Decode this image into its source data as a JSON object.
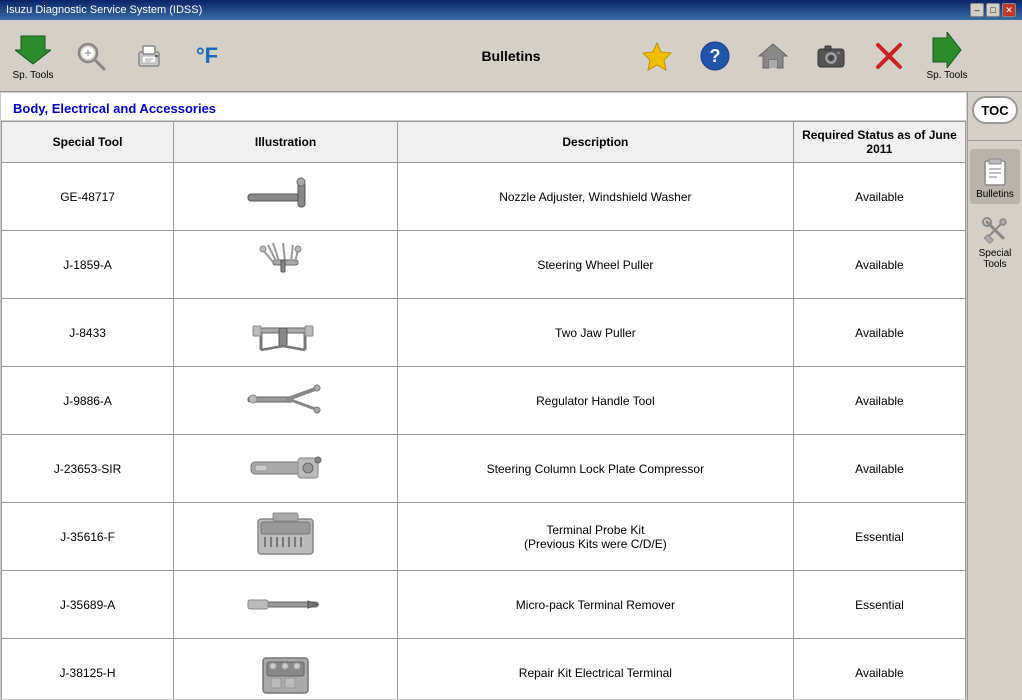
{
  "titlebar": {
    "title": "Isuzu Diagnostic Service System (IDSS)",
    "min_btn": "–",
    "max_btn": "□",
    "close_btn": "✕"
  },
  "toolbar": {
    "center_label": "Bulletins",
    "left_tools": [
      {
        "id": "sp-tools-left",
        "label": "Sp. Tools"
      },
      {
        "id": "magnifier",
        "label": ""
      },
      {
        "id": "printer",
        "label": ""
      },
      {
        "id": "temperature",
        "label": ""
      }
    ],
    "right_tools": [
      {
        "id": "star",
        "label": ""
      },
      {
        "id": "question",
        "label": ""
      },
      {
        "id": "home",
        "label": ""
      },
      {
        "id": "camera",
        "label": ""
      },
      {
        "id": "close-x",
        "label": ""
      },
      {
        "id": "sp-tools-right",
        "label": "Sp. Tools"
      }
    ]
  },
  "content": {
    "header": "Body, Electrical and Accessories",
    "table": {
      "columns": [
        "Special Tool",
        "Illustration",
        "Description",
        "Required Status as of June 2011"
      ],
      "rows": [
        {
          "tool_id": "GE-48717",
          "description": "Nozzle Adjuster, Windshield Washer",
          "status": "Available"
        },
        {
          "tool_id": "J-1859-A",
          "description": "Steering Wheel Puller",
          "status": "Available"
        },
        {
          "tool_id": "J-8433",
          "description": "Two Jaw Puller",
          "status": "Available"
        },
        {
          "tool_id": "J-9886-A",
          "description": "Regulator Handle Tool",
          "status": "Available"
        },
        {
          "tool_id": "J-23653-SIR",
          "description": "Steering Column Lock Plate Compressor",
          "status": "Available"
        },
        {
          "tool_id": "J-35616-F",
          "description": "Terminal Probe Kit\n(Previous Kits were C/D/E)",
          "status": "Essential"
        },
        {
          "tool_id": "J-35689-A",
          "description": "Micro-pack Terminal Remover",
          "status": "Essential"
        },
        {
          "tool_id": "J-38125-H",
          "description": "Repair Kit Electrical Terminal",
          "status": "Available"
        }
      ]
    }
  },
  "sidebar": {
    "toc_label": "TOC",
    "items": [
      {
        "id": "bulletins",
        "label": "Bulletins",
        "active": true
      },
      {
        "id": "special-tools",
        "label": "Special Tools",
        "active": false
      }
    ]
  }
}
